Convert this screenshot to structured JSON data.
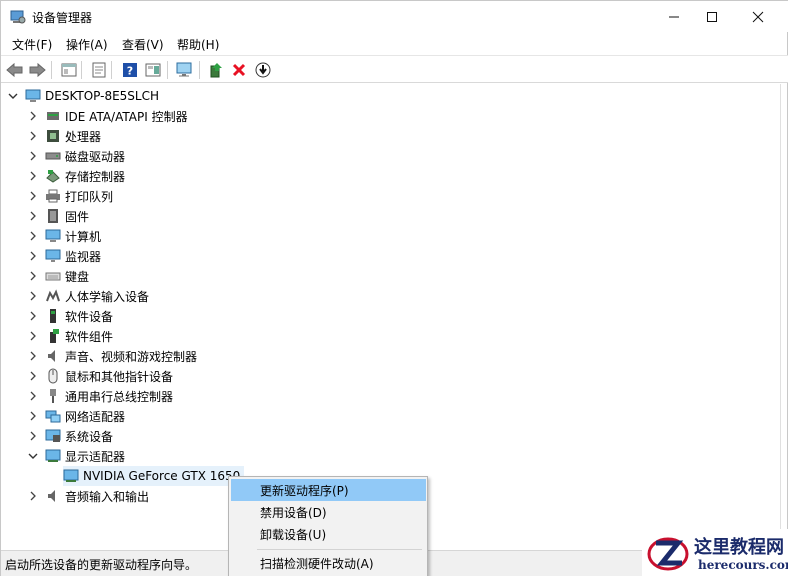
{
  "window": {
    "title": "设备管理器"
  },
  "menu": [
    "文件(F)",
    "操作(A)",
    "查看(V)",
    "帮助(H)"
  ],
  "tree": {
    "root": "DESKTOP-8E5SLCH",
    "categories": [
      "IDE ATA/ATAPI 控制器",
      "处理器",
      "磁盘驱动器",
      "存储控制器",
      "打印队列",
      "固件",
      "计算机",
      "监视器",
      "键盘",
      "人体学输入设备",
      "软件设备",
      "软件组件",
      "声音、视频和游戏控制器",
      "鼠标和其他指针设备",
      "通用串行总线控制器",
      "网络适配器",
      "系统设备",
      "显示适配器",
      "音频输入和输出"
    ],
    "expanded_category": "显示适配器",
    "child_device": "NVIDIA GeForce GTX 1650"
  },
  "context_menu": {
    "items": [
      "更新驱动程序(P)",
      "禁用设备(D)",
      "卸载设备(U)",
      "扫描检测硬件改动(A)"
    ],
    "highlighted_index": 0
  },
  "status_text": "启动所选设备的更新驱动程序向导。",
  "watermark": {
    "cn": "这里教程网",
    "en": "herecours.com"
  },
  "colors": {
    "selection": "#e5f1fb",
    "menu_highlight": "#91c9f7",
    "delete_red": "#e81123",
    "help_blue": "#1e4fa8",
    "watermark_blue": "#1b2b6b"
  }
}
